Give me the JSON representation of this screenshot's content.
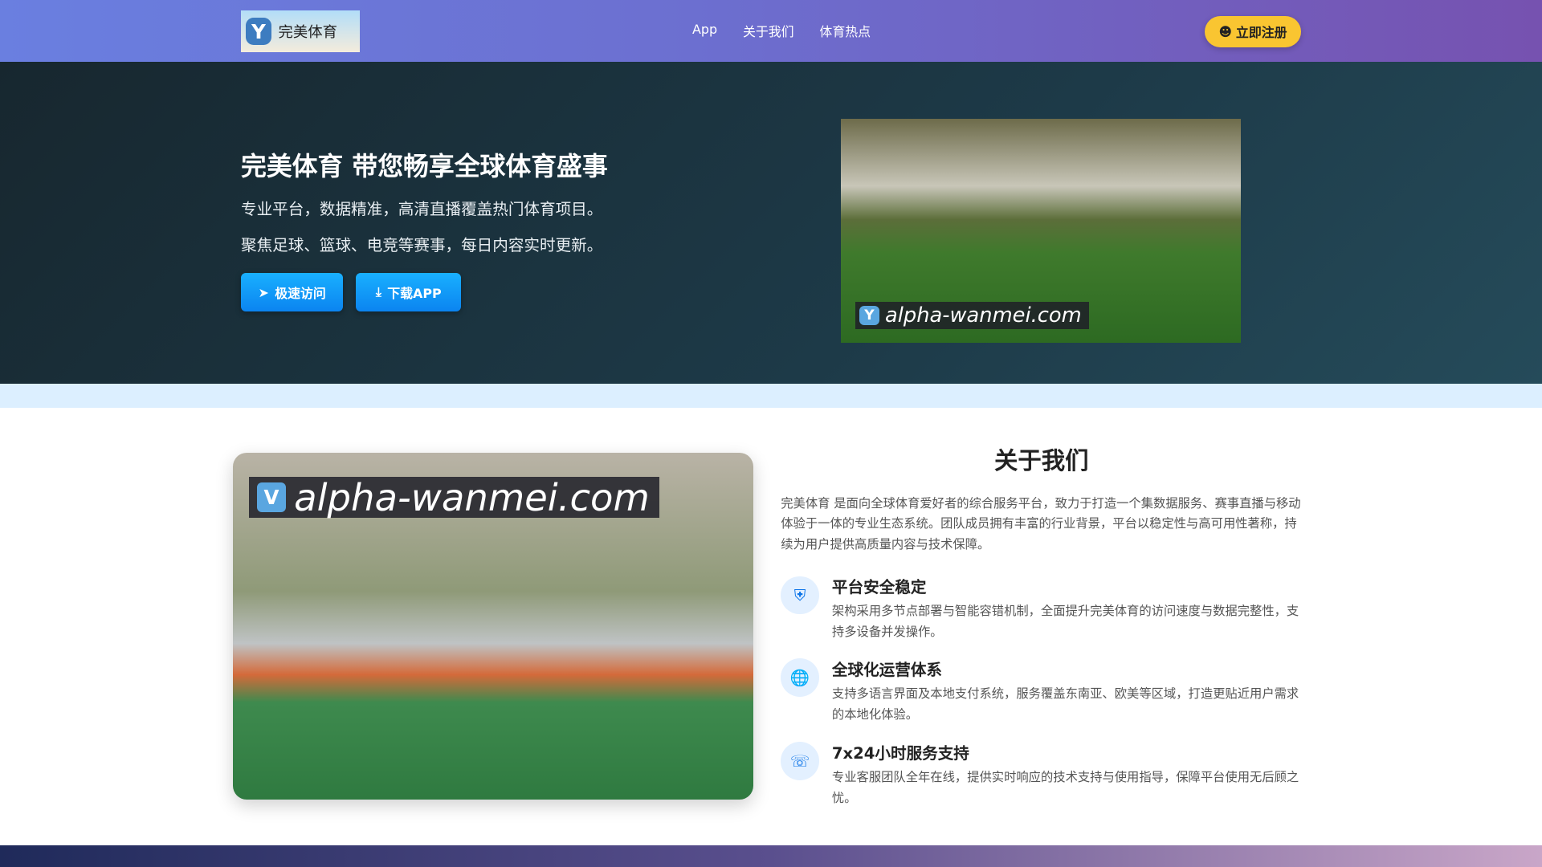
{
  "nav": {
    "brand": "完美体育",
    "logo_letter": "Y",
    "links": [
      "App",
      "关于我们",
      "体育热点"
    ],
    "register": "立即注册"
  },
  "hero": {
    "title": "完美体育 带您畅享全球体育盛事",
    "line1": "专业平台，数据精准，高清直播覆盖热门体育项目。",
    "line2": "聚焦足球、篮球、电竞等赛事，每日内容实时更新。",
    "btn_fast": "极速访问",
    "btn_download": "下载APP",
    "watermark": "alpha-wanmei.com",
    "watermark_letter": "Y"
  },
  "about": {
    "title": "关于我们",
    "desc": "完美体育 是面向全球体育爱好者的综合服务平台，致力于打造一个集数据服务、赛事直播与移动体验于一体的专业生态系统。团队成员拥有丰富的行业背景，平台以稳定性与高可用性著称，持续为用户提供高质量内容与技术保障。",
    "watermark": "alpha-wanmei.com",
    "watermark_letter": "V",
    "features": [
      {
        "icon": "shield-icon",
        "title": "平台安全稳定",
        "text": "架构采用多节点部署与智能容错机制，全面提升完美体育的访问速度与数据完整性，支持多设备并发操作。"
      },
      {
        "icon": "globe-icon",
        "title": "全球化运营体系",
        "text": "支持多语言界面及本地支付系统，服务覆盖东南亚、欧美等区域，打造更贴近用户需求的本地化体验。"
      },
      {
        "icon": "headset-icon",
        "title": "7x24小时服务支持",
        "text": "专业客服团队全年在线，提供实时响应的技术支持与使用指导，保障平台使用无后顾之忧。"
      }
    ]
  }
}
